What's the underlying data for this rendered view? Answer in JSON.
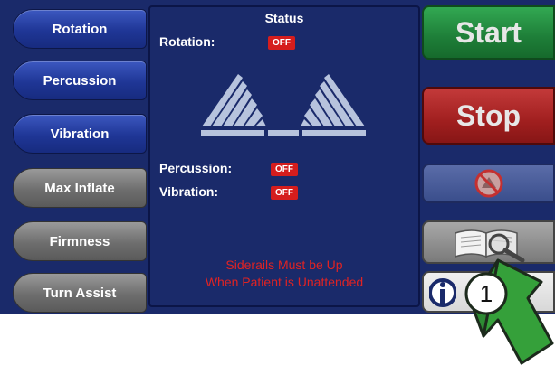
{
  "left_menu": {
    "rotation": "Rotation",
    "percussion": "Percussion",
    "vibration": "Vibration",
    "max_inflate": "Max Inflate",
    "firmness": "Firmness",
    "turn_assist": "Turn Assist"
  },
  "status": {
    "title": "Status",
    "rotation_label": "Rotation:",
    "rotation_value": "OFF",
    "percussion_label": "Percussion:",
    "percussion_value": "OFF",
    "vibration_label": "Vibration:",
    "vibration_value": "OFF",
    "warning_line1": "Siderails Must be Up",
    "warning_line2": "When Patient is Unattended"
  },
  "right_menu": {
    "start": "Start",
    "stop": "Stop"
  },
  "callout": {
    "number": "1"
  },
  "colors": {
    "screen_bg": "#1a2a6a",
    "start_green": "#1e7e38",
    "stop_red": "#a11f1f",
    "off_badge": "#d51d1d",
    "warning_text": "#e02323",
    "callout_green": "#35a03a"
  },
  "icons": [
    "rotation-bed-icon",
    "no-tilt-icon",
    "manual-magnifier-icon",
    "help-icon"
  ]
}
